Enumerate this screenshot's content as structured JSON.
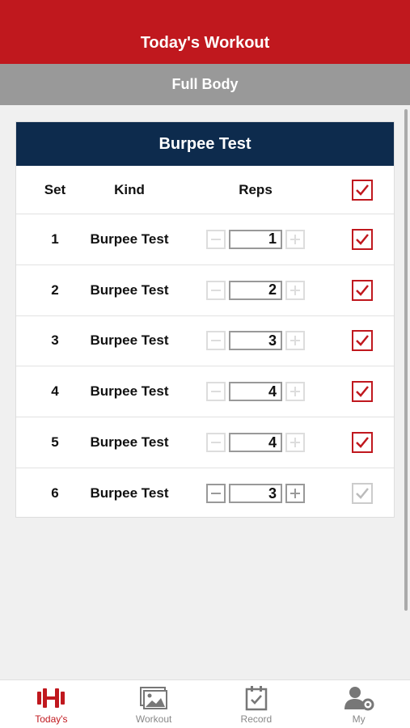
{
  "header": {
    "title": "Today's Workout"
  },
  "subheader": {
    "title": "Full Body"
  },
  "card": {
    "title": "Burpee Test",
    "columns": {
      "set": "Set",
      "kind": "Kind",
      "reps": "Reps"
    },
    "rows": [
      {
        "set": "1",
        "kind": "Burpee Test",
        "reps": "1",
        "checked": true
      },
      {
        "set": "2",
        "kind": "Burpee Test",
        "reps": "2",
        "checked": true
      },
      {
        "set": "3",
        "kind": "Burpee Test",
        "reps": "3",
        "checked": true
      },
      {
        "set": "4",
        "kind": "Burpee Test",
        "reps": "4",
        "checked": true
      },
      {
        "set": "5",
        "kind": "Burpee Test",
        "reps": "4",
        "checked": true
      },
      {
        "set": "6",
        "kind": "Burpee Test",
        "reps": "3",
        "checked": false
      }
    ]
  },
  "tabs": [
    {
      "label": "Today's",
      "icon": "dumbbell-icon",
      "active": true
    },
    {
      "label": "Workout",
      "icon": "images-icon",
      "active": false
    },
    {
      "label": "Record",
      "icon": "calendar-check-icon",
      "active": false
    },
    {
      "label": "My",
      "icon": "user-gear-icon",
      "active": false
    }
  ],
  "colors": {
    "primary": "#c0181e",
    "navy": "#0d2b4d",
    "subheader": "#999999"
  }
}
